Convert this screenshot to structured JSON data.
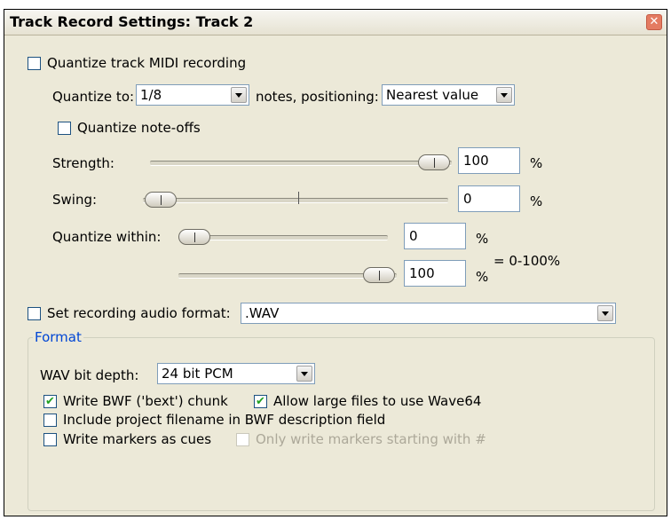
{
  "window": {
    "title": "Track Record Settings: Track 2",
    "close_glyph": "✕"
  },
  "quantize": {
    "enable_label": "Quantize track MIDI recording",
    "enable_checked": false,
    "to_label": "Quantize to:",
    "to_value": "1/8",
    "positioning_label": "notes, positioning:",
    "positioning_value": "Nearest value",
    "note_offs_label": "Quantize note-offs",
    "note_offs_checked": false,
    "strength_label": "Strength:",
    "strength_value": "100",
    "strength_unit": "%",
    "swing_label": "Swing:",
    "swing_value": "0",
    "swing_unit": "%",
    "within_label": "Quantize within:",
    "within_min_value": "0",
    "within_min_unit": "%",
    "within_max_value": "100",
    "within_max_unit": "%",
    "within_range_note": "= 0-100%"
  },
  "audio_format": {
    "enable_label": "Set recording audio format:",
    "enable_checked": false,
    "format_value": ".WAV"
  },
  "format_group": {
    "legend": "Format",
    "bit_depth_label": "WAV bit depth:",
    "bit_depth_value": "24 bit PCM",
    "bwf_label": "Write BWF ('bext') chunk",
    "bwf_checked": true,
    "wave64_label": "Allow large files to use Wave64",
    "wave64_checked": true,
    "include_project_label": "Include project filename in BWF description field",
    "include_project_checked": false,
    "markers_cues_label": "Write markers as cues",
    "markers_cues_checked": false,
    "only_hash_label": "Only write markers starting with #",
    "only_hash_checked": false
  },
  "icons": {
    "checkmark": "✔",
    "dropdown": "chevron-down-icon",
    "close": "close-icon"
  }
}
